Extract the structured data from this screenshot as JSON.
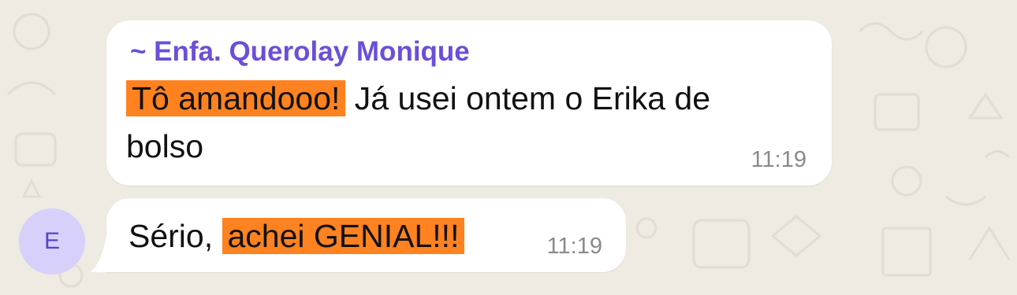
{
  "chat": {
    "messages": [
      {
        "sender": "~ Enfa. Querolay Monique",
        "line1_highlight": "Tô amandooo!",
        "line1_rest": " Já usei ontem o Erika de",
        "line2": "bolso",
        "time": "11:19"
      },
      {
        "text_start": "Sério, ",
        "text_highlight": "achei GENIAL!!!",
        "time": "11:19",
        "avatar_initial": "E"
      }
    ]
  },
  "colors": {
    "background": "#efeae2",
    "bubble": "#ffffff",
    "sender_name": "#6b4fd8",
    "highlight": "#ff8220",
    "timestamp": "#8a8a8a",
    "avatar_bg": "#d7d0fa",
    "avatar_text": "#5a43c8"
  },
  "icons": {
    "wallpaper": "chat-doodle-pattern-icon"
  }
}
